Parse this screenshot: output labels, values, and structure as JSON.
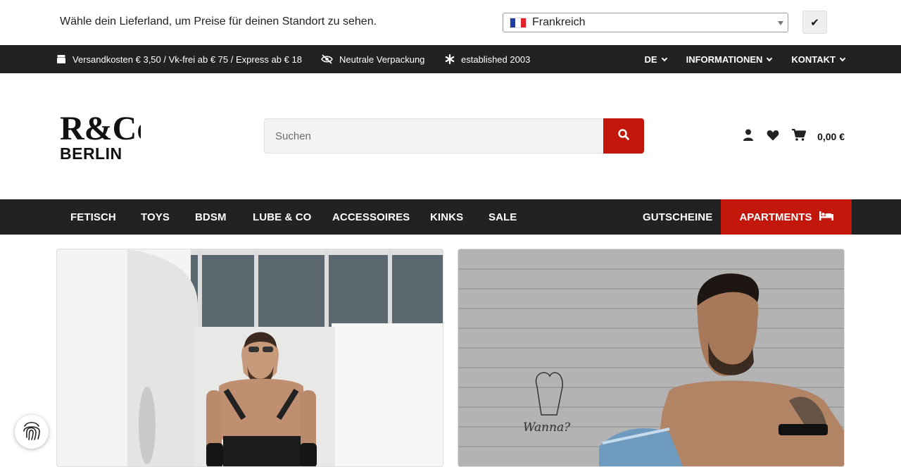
{
  "country_bar": {
    "message": "Wähle dein Lieferland, um Preise für deinen Standort zu sehen.",
    "selected_country": "Frankreich",
    "confirm_label": "✔"
  },
  "info_bar": {
    "shipping": "Versandkosten € 3,50 / Vk-frei ab € 75 / Express ab € 18",
    "packaging": "Neutrale Verpackung",
    "established": "established 2003",
    "language": "DE",
    "information": "INFORMATIONEN",
    "contact": "KONTAKT"
  },
  "header": {
    "logo_text": "BERLIN",
    "logo_mark": "R&Co",
    "search_placeholder": "Suchen",
    "cart_total": "0,00 €"
  },
  "nav": {
    "items": [
      "FETISCH",
      "TOYS",
      "BDSM",
      "LUBE & CO",
      "ACCESSOIRES",
      "KINKS",
      "SALE"
    ],
    "vouchers": "GUTSCHEINE",
    "apartments": "APARTMENTS"
  },
  "colors": {
    "brand_red": "#c4170c",
    "dark_bar": "#222222"
  },
  "banners": {
    "right_caption": "Wanna?"
  },
  "icons": [
    "box-icon",
    "eye-slash-icon",
    "asterisk-icon",
    "search-icon",
    "user-icon",
    "heart-icon",
    "cart-icon",
    "bed-icon",
    "fingerprint-icon"
  ]
}
